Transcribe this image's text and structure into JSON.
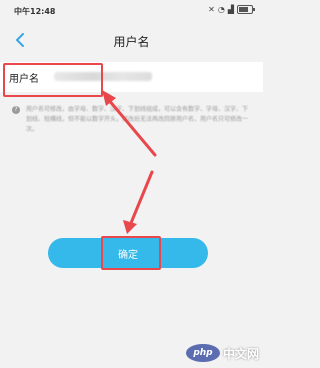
{
  "status_bar": {
    "time": "中午12:48",
    "icons": [
      "mute-icon",
      "wifi-icon",
      "signal-icon",
      "battery-icon"
    ]
  },
  "nav": {
    "title": "用户名",
    "back_icon": "chevron-left-icon"
  },
  "username_field": {
    "label": "用户名"
  },
  "hint": {
    "icon": "help-icon",
    "text": "用户名可修改，由字母、数字、汉字、下划线组成，可以含有数字、字母、汉字、下划线、短横线，但不能以数字开头，修改后无法再改回原用户名，用户名只可修改一次。"
  },
  "confirm_button": {
    "label": "确定"
  },
  "watermark": {
    "logo": "php",
    "text": "中文网"
  },
  "colors": {
    "accent": "#35b8ea",
    "highlight": "#e8474c",
    "background": "#f2f2f2"
  }
}
